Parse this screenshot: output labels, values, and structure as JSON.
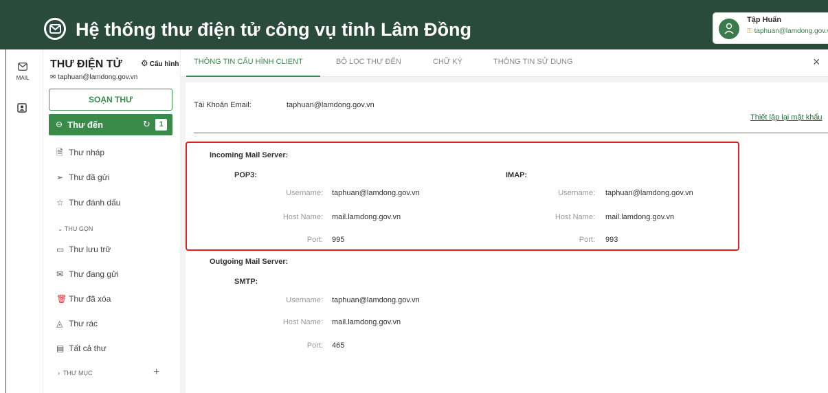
{
  "header": {
    "title": "Hệ thống thư điện tử công vụ tỉnh Lâm Đồng",
    "logo_icon": "mail-circle-icon",
    "user_name": "Tập Huấn",
    "user_email": "taphuan@lamdong.gov.vn"
  },
  "rail": {
    "mail_label": "MAIL"
  },
  "sidebar": {
    "title": "THƯ ĐIỆN TỬ",
    "config_label": "Cấu hình",
    "account_email": "taphuan@lamdong.gov.vn",
    "compose_label": "SOẠN THƯ",
    "inbox_label": "Thư đến",
    "inbox_badge": "1",
    "items": [
      {
        "label": "Thư nháp",
        "icon": "draft-icon"
      },
      {
        "label": "Thư đã gửi",
        "icon": "send-icon"
      },
      {
        "label": "Thư đánh dấu",
        "icon": "star-icon"
      }
    ],
    "collapse_label": "THU GỌN",
    "items2": [
      {
        "label": "Thư lưu trữ",
        "icon": "archive-icon"
      },
      {
        "label": "Thư đang gửi",
        "icon": "outbox-icon"
      },
      {
        "label": "Thư đã xóa",
        "icon": "trash-icon"
      },
      {
        "label": "Thư rác",
        "icon": "spam-icon"
      },
      {
        "label": "Tất cả thư",
        "icon": "all-mail-icon"
      }
    ],
    "folders_label": "THƯ MỤC"
  },
  "tabs": [
    {
      "label": "THÔNG TIN CẤU HÌNH CLIENT",
      "active": true
    },
    {
      "label": "BỘ LỌC THƯ ĐẾN",
      "active": false
    },
    {
      "label": "CHỮ KÝ",
      "active": false
    },
    {
      "label": "THÔNG TIN SỬ DỤNG",
      "active": false
    }
  ],
  "account": {
    "label": "Tài Khoản Email:",
    "value": "taphuan@lamdong.gov.vn",
    "reset_link": "Thiết lập lại mật khẩu"
  },
  "incoming": {
    "title": "Incoming Mail Server:",
    "pop3": {
      "name": "POP3:",
      "username_label": "Username:",
      "username": "taphuan@lamdong.gov.vn",
      "host_label": "Host Name:",
      "host": "mail.lamdong.gov.vn",
      "port_label": "Port:",
      "port": "995"
    },
    "imap": {
      "name": "IMAP:",
      "username_label": "Username:",
      "username": "taphuan@lamdong.gov.vn",
      "host_label": "Host Name:",
      "host": "mail.lamdong.gov.vn",
      "port_label": "Port:",
      "port": "993"
    }
  },
  "outgoing": {
    "title": "Outgoing Mail Server:",
    "smtp": {
      "name": "SMTP:",
      "username_label": "Username:",
      "username": "taphuan@lamdong.gov.vn",
      "host_label": "Host Name:",
      "host": "mail.lamdong.gov.vn",
      "port_label": "Port:",
      "port": "465"
    }
  },
  "colors": {
    "header_bg": "#2a4a3c",
    "accent": "#3a8a4a",
    "highlight_border": "#e02020"
  }
}
